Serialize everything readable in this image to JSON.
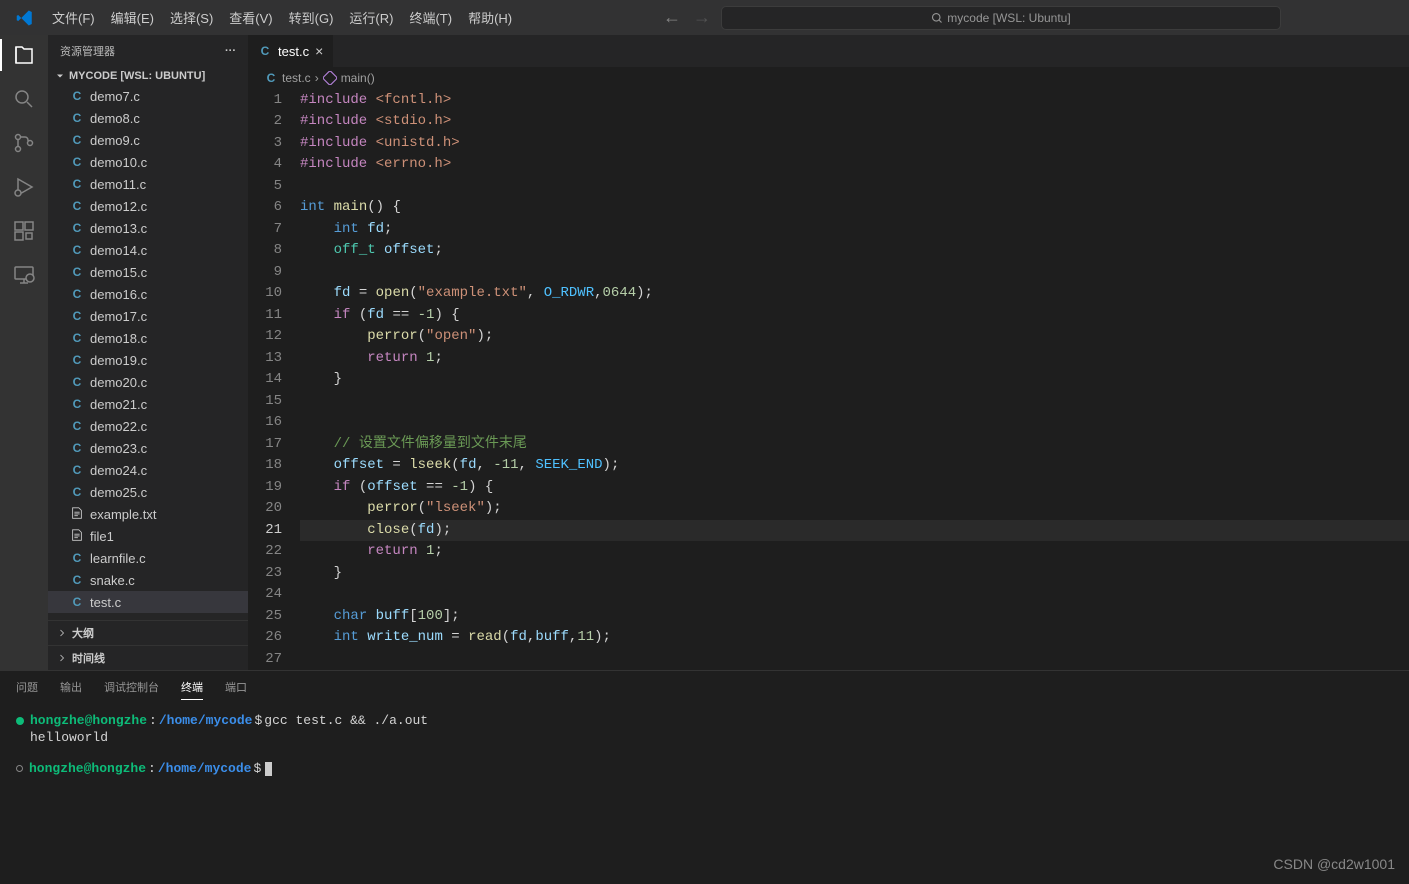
{
  "menubar": {
    "items": [
      "文件(F)",
      "编辑(E)",
      "选择(S)",
      "查看(V)",
      "转到(G)",
      "运行(R)",
      "终端(T)",
      "帮助(H)"
    ],
    "search": "mycode [WSL: Ubuntu]"
  },
  "sidebar": {
    "title": "资源管理器",
    "project": "MYCODE [WSL: UBUNTU]",
    "files": [
      {
        "icon": "C",
        "name": "demo7.c"
      },
      {
        "icon": "C",
        "name": "demo8.c"
      },
      {
        "icon": "C",
        "name": "demo9.c"
      },
      {
        "icon": "C",
        "name": "demo10.c"
      },
      {
        "icon": "C",
        "name": "demo11.c"
      },
      {
        "icon": "C",
        "name": "demo12.c"
      },
      {
        "icon": "C",
        "name": "demo13.c"
      },
      {
        "icon": "C",
        "name": "demo14.c"
      },
      {
        "icon": "C",
        "name": "demo15.c"
      },
      {
        "icon": "C",
        "name": "demo16.c"
      },
      {
        "icon": "C",
        "name": "demo17.c"
      },
      {
        "icon": "C",
        "name": "demo18.c"
      },
      {
        "icon": "C",
        "name": "demo19.c"
      },
      {
        "icon": "C",
        "name": "demo20.c"
      },
      {
        "icon": "C",
        "name": "demo21.c"
      },
      {
        "icon": "C",
        "name": "demo22.c"
      },
      {
        "icon": "C",
        "name": "demo23.c"
      },
      {
        "icon": "C",
        "name": "demo24.c"
      },
      {
        "icon": "C",
        "name": "demo25.c"
      },
      {
        "icon": "txt",
        "name": "example.txt"
      },
      {
        "icon": "txt",
        "name": "file1"
      },
      {
        "icon": "C",
        "name": "learnfile.c"
      },
      {
        "icon": "C",
        "name": "snake.c"
      },
      {
        "icon": "C",
        "name": "test.c",
        "active": true
      }
    ],
    "sections": [
      "大纲",
      "时间线"
    ]
  },
  "tab": {
    "label": "test.c"
  },
  "breadcrumb": {
    "file": "test.c",
    "symbol": "main()"
  },
  "code": {
    "lines": [
      {
        "n": 1,
        "tokens": [
          [
            "kw2",
            "#include"
          ],
          [
            "plain",
            " "
          ],
          [
            "str",
            "<fcntl.h>"
          ]
        ]
      },
      {
        "n": 2,
        "tokens": [
          [
            "kw2",
            "#include"
          ],
          [
            "plain",
            " "
          ],
          [
            "str",
            "<stdio.h>"
          ]
        ]
      },
      {
        "n": 3,
        "tokens": [
          [
            "kw2",
            "#include"
          ],
          [
            "plain",
            " "
          ],
          [
            "str",
            "<unistd.h>"
          ]
        ]
      },
      {
        "n": 4,
        "tokens": [
          [
            "kw2",
            "#include"
          ],
          [
            "plain",
            " "
          ],
          [
            "str",
            "<errno.h>"
          ]
        ]
      },
      {
        "n": 5,
        "tokens": []
      },
      {
        "n": 6,
        "tokens": [
          [
            "kw",
            "int"
          ],
          [
            "plain",
            " "
          ],
          [
            "fn",
            "main"
          ],
          [
            "plain",
            "() {"
          ]
        ]
      },
      {
        "n": 7,
        "tokens": [
          [
            "plain",
            "    "
          ],
          [
            "kw",
            "int"
          ],
          [
            "plain",
            " "
          ],
          [
            "var",
            "fd"
          ],
          [
            "plain",
            ";"
          ]
        ]
      },
      {
        "n": 8,
        "tokens": [
          [
            "plain",
            "    "
          ],
          [
            "type",
            "off_t"
          ],
          [
            "plain",
            " "
          ],
          [
            "var",
            "offset"
          ],
          [
            "plain",
            ";"
          ]
        ]
      },
      {
        "n": 9,
        "tokens": []
      },
      {
        "n": 10,
        "tokens": [
          [
            "plain",
            "    "
          ],
          [
            "var",
            "fd"
          ],
          [
            "plain",
            " = "
          ],
          [
            "fn",
            "open"
          ],
          [
            "plain",
            "("
          ],
          [
            "str",
            "\"example.txt\""
          ],
          [
            "plain",
            ", "
          ],
          [
            "const",
            "O_RDWR"
          ],
          [
            "plain",
            ","
          ],
          [
            "num",
            "0644"
          ],
          [
            "plain",
            ");"
          ]
        ]
      },
      {
        "n": 11,
        "tokens": [
          [
            "plain",
            "    "
          ],
          [
            "kw2",
            "if"
          ],
          [
            "plain",
            " ("
          ],
          [
            "var",
            "fd"
          ],
          [
            "plain",
            " == "
          ],
          [
            "num",
            "-1"
          ],
          [
            "plain",
            ") {"
          ]
        ]
      },
      {
        "n": 12,
        "tokens": [
          [
            "plain",
            "        "
          ],
          [
            "fn",
            "perror"
          ],
          [
            "plain",
            "("
          ],
          [
            "str",
            "\"open\""
          ],
          [
            "plain",
            ");"
          ]
        ]
      },
      {
        "n": 13,
        "tokens": [
          [
            "plain",
            "        "
          ],
          [
            "kw2",
            "return"
          ],
          [
            "plain",
            " "
          ],
          [
            "num",
            "1"
          ],
          [
            "plain",
            ";"
          ]
        ]
      },
      {
        "n": 14,
        "tokens": [
          [
            "plain",
            "    }"
          ]
        ]
      },
      {
        "n": 15,
        "tokens": []
      },
      {
        "n": 16,
        "tokens": []
      },
      {
        "n": 17,
        "tokens": [
          [
            "plain",
            "    "
          ],
          [
            "cm",
            "// 设置文件偏移量到文件末尾"
          ]
        ]
      },
      {
        "n": 18,
        "tokens": [
          [
            "plain",
            "    "
          ],
          [
            "var",
            "offset"
          ],
          [
            "plain",
            " = "
          ],
          [
            "fn",
            "lseek"
          ],
          [
            "plain",
            "("
          ],
          [
            "var",
            "fd"
          ],
          [
            "plain",
            ", "
          ],
          [
            "num",
            "-11"
          ],
          [
            "plain",
            ", "
          ],
          [
            "const",
            "SEEK_END"
          ],
          [
            "plain",
            ");"
          ]
        ]
      },
      {
        "n": 19,
        "tokens": [
          [
            "plain",
            "    "
          ],
          [
            "kw2",
            "if"
          ],
          [
            "plain",
            " ("
          ],
          [
            "var",
            "offset"
          ],
          [
            "plain",
            " == "
          ],
          [
            "num",
            "-1"
          ],
          [
            "plain",
            ") {"
          ]
        ]
      },
      {
        "n": 20,
        "tokens": [
          [
            "plain",
            "        "
          ],
          [
            "fn",
            "perror"
          ],
          [
            "plain",
            "("
          ],
          [
            "str",
            "\"lseek\""
          ],
          [
            "plain",
            ");"
          ]
        ]
      },
      {
        "n": 21,
        "active": true,
        "tokens": [
          [
            "plain",
            "        "
          ],
          [
            "fn",
            "close"
          ],
          [
            "plain",
            "("
          ],
          [
            "var",
            "fd"
          ],
          [
            "plain",
            ");"
          ]
        ]
      },
      {
        "n": 22,
        "tokens": [
          [
            "plain",
            "        "
          ],
          [
            "kw2",
            "return"
          ],
          [
            "plain",
            " "
          ],
          [
            "num",
            "1"
          ],
          [
            "plain",
            ";"
          ]
        ]
      },
      {
        "n": 23,
        "tokens": [
          [
            "plain",
            "    }"
          ]
        ]
      },
      {
        "n": 24,
        "tokens": []
      },
      {
        "n": 25,
        "tokens": [
          [
            "plain",
            "    "
          ],
          [
            "kw",
            "char"
          ],
          [
            "plain",
            " "
          ],
          [
            "var",
            "buff"
          ],
          [
            "plain",
            "["
          ],
          [
            "num",
            "100"
          ],
          [
            "plain",
            "];"
          ]
        ]
      },
      {
        "n": 26,
        "tokens": [
          [
            "plain",
            "    "
          ],
          [
            "kw",
            "int"
          ],
          [
            "plain",
            " "
          ],
          [
            "var",
            "write_num"
          ],
          [
            "plain",
            " = "
          ],
          [
            "fn",
            "read"
          ],
          [
            "plain",
            "("
          ],
          [
            "var",
            "fd"
          ],
          [
            "plain",
            ","
          ],
          [
            "var",
            "buff"
          ],
          [
            "plain",
            ","
          ],
          [
            "num",
            "11"
          ],
          [
            "plain",
            ");"
          ]
        ]
      },
      {
        "n": 27,
        "tokens": []
      }
    ]
  },
  "panel": {
    "tabs": [
      "问题",
      "输出",
      "调试控制台",
      "终端",
      "端口"
    ],
    "activeTab": "终端",
    "terminal": {
      "user": "hongzhe@hongzhe",
      "path": "/home/mycode",
      "cmd": "gcc test.c && ./a.out",
      "output": "helloworld"
    }
  },
  "watermark": "CSDN @cd2w1001"
}
